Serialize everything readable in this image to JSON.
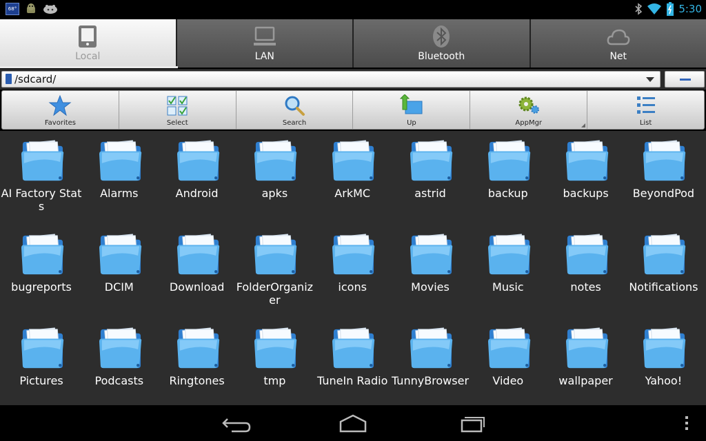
{
  "status_bar": {
    "temperature": "68°",
    "time": "5:30",
    "icons": [
      "weather-badge-icon",
      "android-robot-icon",
      "game-controller-icon",
      "bluetooth-icon",
      "wifi-icon",
      "battery-charging-icon"
    ],
    "clock_color": "#33b5e5"
  },
  "tabs": [
    {
      "label": "Local",
      "icon": "tablet-icon",
      "active": true
    },
    {
      "label": "LAN",
      "icon": "computer-icon",
      "active": false
    },
    {
      "label": "Bluetooth",
      "icon": "bluetooth-icon",
      "active": false
    },
    {
      "label": "Net",
      "icon": "cloud-icon",
      "active": false
    }
  ],
  "path_bar": {
    "path": "/sdcard/",
    "icon": "sdcard-icon",
    "dropdown_icon": "dropdown-arrow-icon",
    "side_button_icon": "minus-icon"
  },
  "toolbar": [
    {
      "label": "Favorites",
      "icon": "star-icon"
    },
    {
      "label": "Select",
      "icon": "select-grid-icon"
    },
    {
      "label": "Search",
      "icon": "magnifier-icon"
    },
    {
      "label": "Up",
      "icon": "folder-up-icon"
    },
    {
      "label": "AppMgr",
      "icon": "gears-icon"
    },
    {
      "label": "List",
      "icon": "list-view-icon"
    }
  ],
  "folders": [
    "AI Factory Stats",
    "Alarms",
    "Android",
    "apks",
    "ArkMC",
    "astrid",
    "backup",
    "backups",
    "BeyondPod",
    "bugreports",
    "DCIM",
    "Download",
    "FolderOrganizer",
    "icons",
    "Movies",
    "Music",
    "notes",
    "Notifications",
    "Pictures",
    "Podcasts",
    "Ringtones",
    "tmp",
    "TuneIn Radio",
    "TunnyBrowser",
    "Video",
    "wallpaper",
    "Yahoo!"
  ],
  "navigation": [
    "back-icon",
    "home-icon",
    "recent-apps-icon",
    "overflow-menu-icon"
  ],
  "colors": {
    "background": "#2d2d2d",
    "folder_blue": "#4aa3e8",
    "accent_blue": "#33b5e5"
  }
}
